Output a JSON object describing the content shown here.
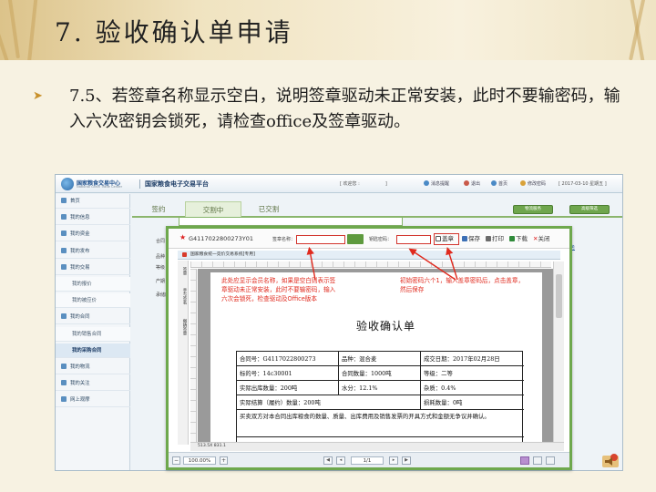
{
  "slide": {
    "title": "7. 验收确认单申请",
    "bullet": "7.5、若签章名称显示空白，说明签章驱动未正常安装，此时不要输密码，输入六次密钥会锁死，请检查office及签章驱动。"
  },
  "app": {
    "logo_text": "国家粮食交易中心",
    "logo_sub": "National Grain Trade Center",
    "platform": "国家粮食电子交易平台",
    "welcome": "[ 欢迎您 :",
    "welcome_end": "]",
    "links": [
      "消息提醒",
      "退出",
      "首页",
      "修改密码"
    ],
    "date": "[ 2017-03-10 星期五 ]",
    "sidebar": [
      {
        "label": "首页",
        "sub": false
      },
      {
        "label": "我的信息",
        "sub": false
      },
      {
        "label": "我的资金",
        "sub": false
      },
      {
        "label": "我的发布",
        "sub": false
      },
      {
        "label": "我的交易",
        "sub": false
      },
      {
        "label": "我的报价",
        "sub": true
      },
      {
        "label": "我的被应价",
        "sub": true
      },
      {
        "label": "我的合同",
        "sub": false
      },
      {
        "label": "我的销售合同",
        "sub": true
      },
      {
        "label": "我的采购合同",
        "sub": true,
        "active": true
      },
      {
        "label": "我的物流",
        "sub": false
      },
      {
        "label": "我的关注",
        "sub": false
      },
      {
        "label": "网上观摩",
        "sub": false
      }
    ],
    "tabs": [
      "签约",
      "交割中",
      "已交割"
    ],
    "green_buttons": [
      "物流服务",
      "高级筛选"
    ],
    "bg_rows": [
      "合同",
      "品种",
      "等级",
      "产期",
      "承储库"
    ],
    "bg_link": "物流服务"
  },
  "modal": {
    "order_id": "G4117022800273Y01",
    "sign_name_label": "签章名称：",
    "sign_name_value": "",
    "key_label": "钥匙密码：",
    "key_value": "",
    "buttons": [
      "盖章",
      "保存",
      "打印",
      "下载",
      "关闭"
    ],
    "doc_tab": "国家粮食统一竞价交易系统[专用]",
    "vertical_tools": [
      "签章",
      "手写签名",
      "撤销签章"
    ],
    "doc_title": "验收确认单",
    "note_left": "此处应显示会员名称，如果是空白则表示签章驱动未正常安装，此时不要输密码，输入六次会锁死，检查驱动及Office版本",
    "note_right": "初始密码六个1，输入盖章密码后，点击盖章，然后保存",
    "table": [
      [
        "合同号：G4117022800273",
        "品种：混合麦",
        "成交日期：2017年02月28日"
      ],
      [
        "标的号：14c30001",
        "合同数量：1000吨",
        "等级：二等"
      ],
      [
        "实际出库数量：200吨",
        "水分：12.1%",
        "杂质：0.4%"
      ],
      [
        "实际结算（履约）数量：200吨",
        "",
        "损耗数量：0吨"
      ]
    ],
    "table_note": "买卖双方对本合同出库粮食的数量、质量、出库费用及销售发票的开具方式和金额无争议并确认。",
    "status_size": "513.5X 831.1",
    "zoom": "100.00%",
    "page": "1/1"
  }
}
